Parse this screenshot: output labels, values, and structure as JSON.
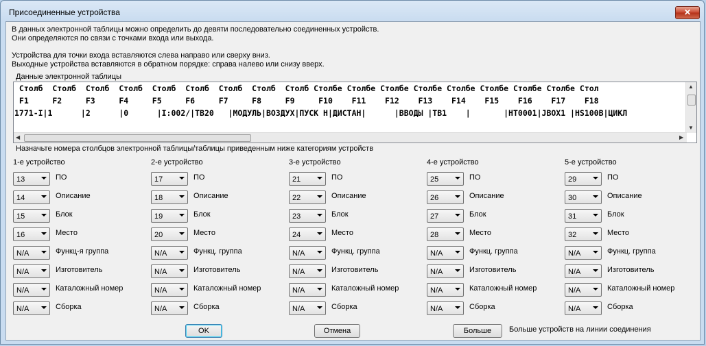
{
  "window": {
    "title": "Присоединенные устройства",
    "close_glyph": "✕"
  },
  "info": {
    "line1": "В данных электронной таблицы можно определить до девяти последовательно соединенных устройств.",
    "line2": "Они определяются по связи с точками входа или выхода.",
    "line3": "Устройства для точки входа вставляются слева направо или сверху вниз.",
    "line4": "Выходные устройства вставляются в обратном порядке: справа налево или снизу вверх."
  },
  "spreadsheet": {
    "label": "Данные электронной таблицы",
    "line1": " Столб  Столб  Столб  Столб  Столб  Столб  Столб  Столб  Столб Столбе Столбе Столбе Столбе Столбе Столбе Столбе Столбе Стол",
    "line2": " F1     F2     F3     F4     F5     F6     F7     F8     F9     F10    F11    F12    F13    F14    F15    F16    F17    F18",
    "line3": "",
    "line4": "1771-I|1      |2      |0      |I:002/|TB20   |МОДУЛЬ|ВОЗДУХ|ПУСК Н|ДИСТАН|      |ВВОДЫ |TB1    |       |HT0001|JBOX1 |HS100B|ЦИКЛ"
  },
  "assign": {
    "label": "Назначьте номера столбцов электронной таблицы/таблицы приведенным ниже категориям устройств",
    "devices": [
      {
        "header": "1-е устройство",
        "values": [
          "13",
          "14",
          "15",
          "16",
          "N/A",
          "N/A",
          "N/A",
          "N/A"
        ],
        "labels": [
          "ПО",
          "Описание",
          "Блок",
          "Место",
          "Функц-я группа",
          "Изготовитель",
          "Каталожный номер",
          "Сборка"
        ]
      },
      {
        "header": "2-е устройство",
        "values": [
          "17",
          "18",
          "19",
          "20",
          "N/A",
          "N/A",
          "N/A",
          "N/A"
        ],
        "labels": [
          "ПО",
          "Описание",
          "Блок",
          "Место",
          "Функц. группа",
          "Изготовитель",
          "Каталожный номер",
          "Сборка"
        ]
      },
      {
        "header": "3-е устройство",
        "values": [
          "21",
          "22",
          "23",
          "24",
          "N/A",
          "N/A",
          "N/A",
          "N/A"
        ],
        "labels": [
          "ПО",
          "Описание",
          "Блок",
          "Место",
          "Функц. группа",
          "Изготовитель",
          "Каталожный номер",
          "Сборка"
        ]
      },
      {
        "header": "4-е устройство",
        "values": [
          "25",
          "26",
          "27",
          "28",
          "N/A",
          "N/A",
          "N/A",
          "N/A"
        ],
        "labels": [
          "ПО",
          "Описание",
          "Блок",
          "Место",
          "Функц. группа",
          "Изготовитель",
          "Каталожный номер",
          "Сборка"
        ]
      },
      {
        "header": "5-е устройство",
        "values": [
          "29",
          "30",
          "31",
          "32",
          "N/A",
          "N/A",
          "N/A",
          "N/A"
        ],
        "labels": [
          "ПО",
          "Описание",
          "Блок",
          "Место",
          "Функц. группа",
          "Изготовитель",
          "Каталожный номер",
          "Сборка"
        ]
      }
    ]
  },
  "buttons": {
    "ok": "OK",
    "cancel": "Отмена",
    "more": "Больше",
    "more_description": "Больше устройств на линии соединения"
  }
}
